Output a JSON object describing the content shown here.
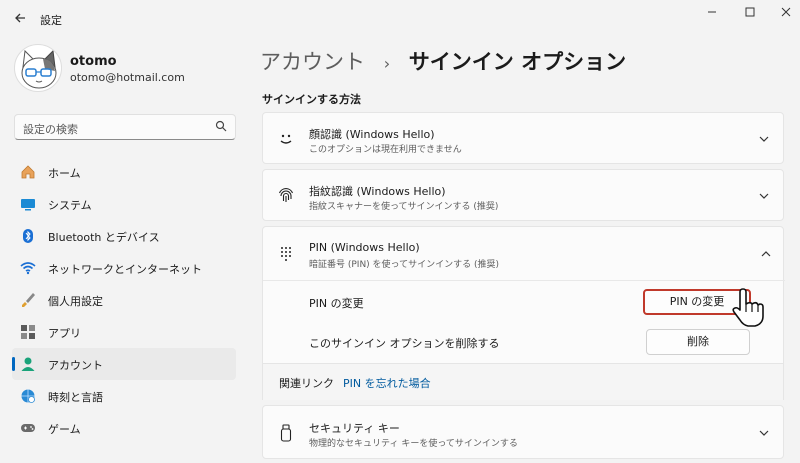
{
  "app": {
    "title": "設定"
  },
  "user": {
    "name": "otomo",
    "email": "otomo@hotmail.com"
  },
  "search": {
    "placeholder": "設定の検索"
  },
  "sidebar": {
    "items": [
      {
        "label": "ホーム",
        "icon": "home-icon"
      },
      {
        "label": "システム",
        "icon": "system-icon"
      },
      {
        "label": "Bluetooth とデバイス",
        "icon": "bluetooth-icon"
      },
      {
        "label": "ネットワークとインターネット",
        "icon": "wifi-icon"
      },
      {
        "label": "個人用設定",
        "icon": "brush-icon"
      },
      {
        "label": "アプリ",
        "icon": "apps-icon"
      },
      {
        "label": "アカウント",
        "icon": "account-icon",
        "active": true
      },
      {
        "label": "時刻と言語",
        "icon": "globe-clock-icon"
      },
      {
        "label": "ゲーム",
        "icon": "gamepad-icon"
      }
    ]
  },
  "breadcrumb": {
    "parent": "アカウント",
    "separator": "›",
    "current": "サインイン オプション"
  },
  "section": {
    "title": "サインインする方法"
  },
  "options": {
    "face": {
      "title": "顔認識 (Windows Hello)",
      "sub": "このオプションは現在利用できません"
    },
    "finger": {
      "title": "指紋認識 (Windows Hello)",
      "sub": "指紋スキャナーを使ってサインインする (推奨)"
    },
    "pin": {
      "title": "PIN (Windows Hello)",
      "sub": "暗証番号 (PIN) を使ってサインインする (推奨)",
      "change_label": "PIN の変更",
      "change_button": "PIN の変更",
      "remove_label": "このサインイン オプションを削除する",
      "remove_button": "削除"
    },
    "key": {
      "title": "セキュリティ キー",
      "sub": "物理的なセキュリティ キーを使ってサインインする"
    }
  },
  "related": {
    "label": "関連リンク",
    "link": "PIN を忘れた場合"
  },
  "colors": {
    "accent": "#0067c0",
    "highlight": "#c0392b"
  }
}
